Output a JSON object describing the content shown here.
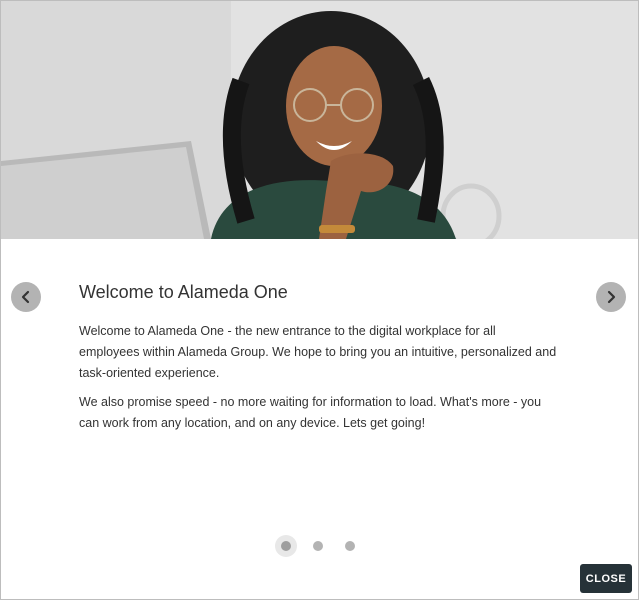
{
  "hero": {
    "image_name": "woman-smiling-at-desk-photo"
  },
  "carousel": {
    "title": "Welcome to Alameda One",
    "paragraphs": [
      "Welcome to Alameda One - the new entrance to the digital workplace for all employees within Alameda Group. We hope to bring you an intuitive, personalized and task-oriented experience.",
      "We also promise speed - no more waiting for information to load. What's more - you can work from any location, and on any device. Lets get going!"
    ],
    "prev_icon": "chevron-left-icon",
    "next_icon": "chevron-right-icon",
    "slide_count": 3,
    "current_slide": 1
  },
  "footer": {
    "close_label": "CLOSE"
  },
  "colors": {
    "close_button_bg": "#263238",
    "nav_button_bg": "#b3b3b3",
    "text": "#333333"
  }
}
